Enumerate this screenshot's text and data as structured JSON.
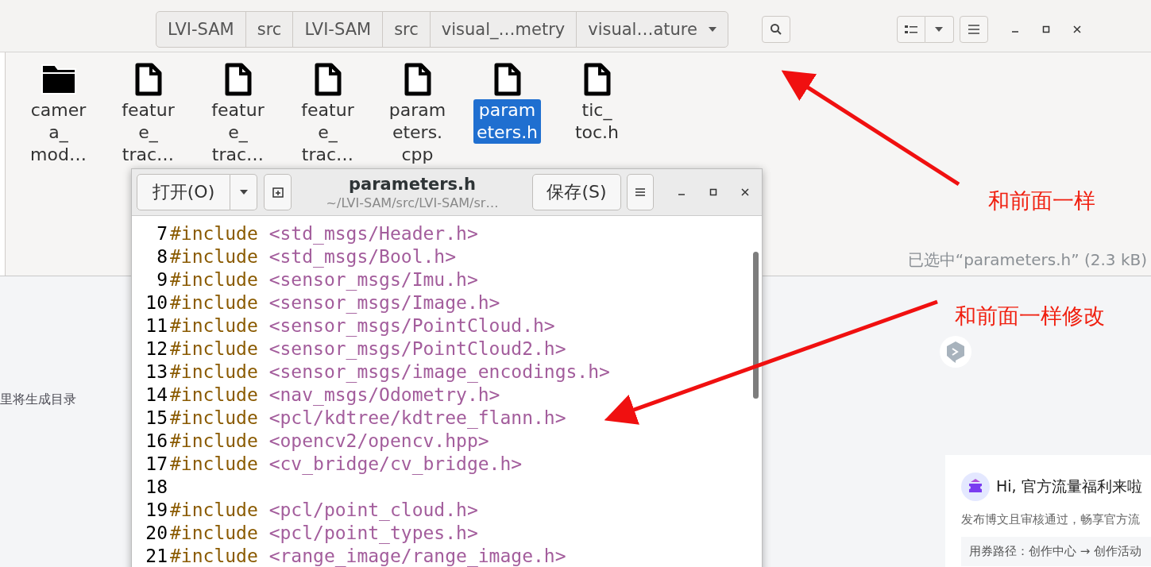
{
  "file_manager": {
    "path_bar": [
      {
        "label": "LVI-SAM",
        "kind": "segment"
      },
      {
        "label": "src",
        "kind": "segment"
      },
      {
        "label": "LVI-SAM",
        "kind": "segment"
      },
      {
        "label": "src",
        "kind": "segment"
      },
      {
        "label": "visual_…metry",
        "kind": "segment"
      },
      {
        "label": "visual…ature",
        "kind": "dropdown"
      }
    ],
    "files": [
      {
        "kind": "folder",
        "label_lines": [
          "camer",
          "a_",
          "mod…"
        ],
        "selected": false
      },
      {
        "kind": "file",
        "label_lines": [
          "featur",
          "e_",
          "trac…"
        ],
        "selected": false
      },
      {
        "kind": "file",
        "label_lines": [
          "featur",
          "e_",
          "trac…"
        ],
        "selected": false
      },
      {
        "kind": "file",
        "label_lines": [
          "featur",
          "e_",
          "trac…"
        ],
        "selected": false
      },
      {
        "kind": "file",
        "label_lines": [
          "param",
          "eters.",
          "cpp"
        ],
        "selected": false
      },
      {
        "kind": "file",
        "label_lines": [
          "param",
          "eters.h"
        ],
        "selected": true
      },
      {
        "kind": "file",
        "label_lines": [
          "tic_",
          "toc.h"
        ],
        "selected": false
      }
    ],
    "status": "已选中“parameters.h” (2.3 kB)"
  },
  "editor": {
    "open_button": "打开(O)",
    "title": "parameters.h",
    "subtitle": "~/LVI-SAM/src/LVI-SAM/sr…",
    "save_button": "保存(S)",
    "lines": [
      {
        "number": "7",
        "directive": "#include",
        "argument": "<std_msgs/Header.h>"
      },
      {
        "number": "8",
        "directive": "#include",
        "argument": "<std_msgs/Bool.h>"
      },
      {
        "number": "9",
        "directive": "#include",
        "argument": "<sensor_msgs/Imu.h>"
      },
      {
        "number": "10",
        "directive": "#include",
        "argument": "<sensor_msgs/Image.h>"
      },
      {
        "number": "11",
        "directive": "#include",
        "argument": "<sensor_msgs/PointCloud.h>"
      },
      {
        "number": "12",
        "directive": "#include",
        "argument": "<sensor_msgs/PointCloud2.h>"
      },
      {
        "number": "13",
        "directive": "#include",
        "argument": "<sensor_msgs/image_encodings.h>"
      },
      {
        "number": "14",
        "directive": "#include",
        "argument": "<nav_msgs/Odometry.h>"
      },
      {
        "number": "15",
        "directive": "#include",
        "argument": "<pcl/kdtree/kdtree_flann.h>"
      },
      {
        "number": "16",
        "directive": "#include",
        "argument": "<opencv2/opencv.hpp>"
      },
      {
        "number": "17",
        "directive": "#include",
        "argument": "<cv_bridge/cv_bridge.h>"
      },
      {
        "number": "18"
      },
      {
        "number": "19",
        "directive": "#include",
        "argument": "<pcl/point_cloud.h>"
      },
      {
        "number": "20",
        "directive": "#include",
        "argument": "<pcl/point_types.h>"
      },
      {
        "number": "21",
        "directive": "#include",
        "argument": "<range_image/range_image.h>"
      }
    ]
  },
  "web_page": {
    "toc_hint": "里将生成目录",
    "promo": {
      "title": "Hi, 官方流量福利来啦",
      "body": "发布博文且审核通过，畅享官方流",
      "path": "用券路径：创作中心 → 创作活动"
    }
  },
  "annotations": [
    "和前面一样",
    "和前面一样修改"
  ]
}
